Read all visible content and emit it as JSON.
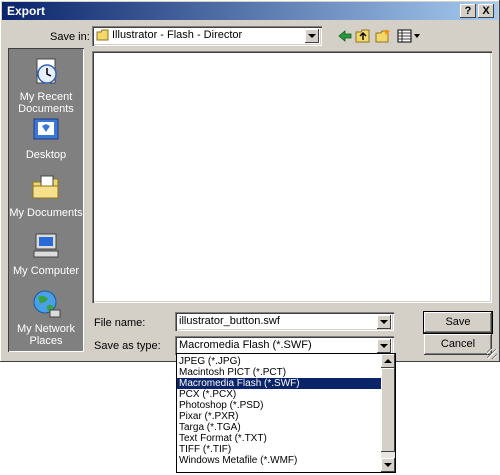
{
  "window": {
    "title": "Export",
    "help_glyph": "?",
    "close_glyph": "X"
  },
  "save_in": {
    "label": "Save in:",
    "value": "Illustrator - Flash - Director"
  },
  "places": [
    {
      "label": "My Recent Documents",
      "icon": "recent-documents-icon"
    },
    {
      "label": "Desktop",
      "icon": "desktop-icon"
    },
    {
      "label": "My Documents",
      "icon": "my-documents-icon"
    },
    {
      "label": "My Computer",
      "icon": "my-computer-icon"
    },
    {
      "label": "My Network Places",
      "icon": "network-places-icon"
    }
  ],
  "file_name": {
    "label": "File name:",
    "value": "illustrator_button.swf"
  },
  "save_as_type": {
    "label": "Save as type:",
    "value": "Macromedia Flash (*.SWF)",
    "options": [
      "JPEG (*.JPG)",
      "Macintosh PICT (*.PCT)",
      "Macromedia Flash (*.SWF)",
      "PCX (*.PCX)",
      "Photoshop (*.PSD)",
      "Pixar (*.PXR)",
      "Targa (*.TGA)",
      "Text Format (*.TXT)",
      "TIFF (*.TIF)",
      "Windows Metafile (*.WMF)"
    ],
    "selected_index": 2
  },
  "buttons": {
    "save": "Save",
    "cancel": "Cancel"
  },
  "colors": {
    "titlebar": "#0a246a",
    "face": "#d4d0c8",
    "selection": "#0a246a"
  }
}
